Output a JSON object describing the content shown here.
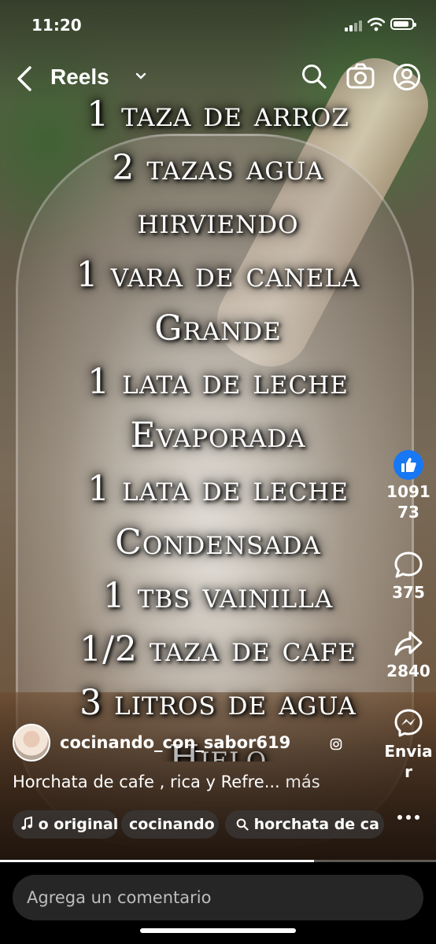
{
  "status": {
    "time": "11:20"
  },
  "header": {
    "title": "Reels"
  },
  "recipe_lines": [
    "1 taza de arroz",
    "2 tazas agua",
    "hirviendo",
    "1 vara de canela",
    "Grande",
    "1 lata de leche",
    "Evaporada",
    "1 lata de leche",
    "Condensada",
    "1 tbs vainilla",
    "1/2 taza de cafe",
    "3 litros de agua",
    "Hielo"
  ],
  "actions": {
    "likes_line1": "1091",
    "likes_line2": "73",
    "comments": "375",
    "shares": "2840",
    "send_line1": "Envia",
    "send_line2": "r"
  },
  "author": {
    "handle": "cocinando_con_sabor619"
  },
  "caption": {
    "text": "Horchata de cafe , rica y Refre...",
    "more": " más"
  },
  "chips": {
    "audio": "o original",
    "account": "cocinando",
    "search": "horchata de ca"
  },
  "progress": 0.72,
  "comment_bar": {
    "placeholder": "Agrega un comentario"
  },
  "colors": {
    "like_blue": "#1877f2",
    "comment_field": "#262626"
  }
}
